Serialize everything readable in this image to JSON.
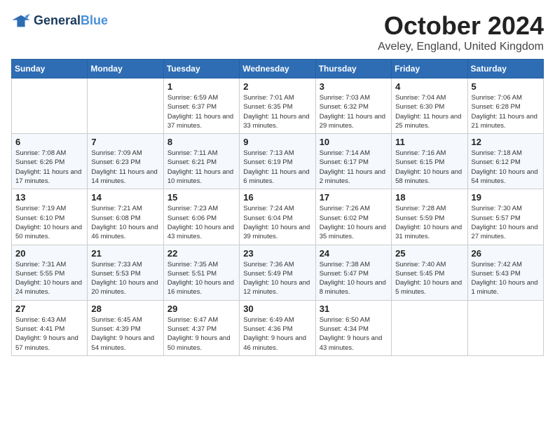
{
  "logo": {
    "line1": "General",
    "line2": "Blue"
  },
  "title": "October 2024",
  "location": "Aveley, England, United Kingdom",
  "days_of_week": [
    "Sunday",
    "Monday",
    "Tuesday",
    "Wednesday",
    "Thursday",
    "Friday",
    "Saturday"
  ],
  "weeks": [
    [
      {
        "day": "",
        "info": ""
      },
      {
        "day": "",
        "info": ""
      },
      {
        "day": "1",
        "info": "Sunrise: 6:59 AM\nSunset: 6:37 PM\nDaylight: 11 hours and 37 minutes."
      },
      {
        "day": "2",
        "info": "Sunrise: 7:01 AM\nSunset: 6:35 PM\nDaylight: 11 hours and 33 minutes."
      },
      {
        "day": "3",
        "info": "Sunrise: 7:03 AM\nSunset: 6:32 PM\nDaylight: 11 hours and 29 minutes."
      },
      {
        "day": "4",
        "info": "Sunrise: 7:04 AM\nSunset: 6:30 PM\nDaylight: 11 hours and 25 minutes."
      },
      {
        "day": "5",
        "info": "Sunrise: 7:06 AM\nSunset: 6:28 PM\nDaylight: 11 hours and 21 minutes."
      }
    ],
    [
      {
        "day": "6",
        "info": "Sunrise: 7:08 AM\nSunset: 6:26 PM\nDaylight: 11 hours and 17 minutes."
      },
      {
        "day": "7",
        "info": "Sunrise: 7:09 AM\nSunset: 6:23 PM\nDaylight: 11 hours and 14 minutes."
      },
      {
        "day": "8",
        "info": "Sunrise: 7:11 AM\nSunset: 6:21 PM\nDaylight: 11 hours and 10 minutes."
      },
      {
        "day": "9",
        "info": "Sunrise: 7:13 AM\nSunset: 6:19 PM\nDaylight: 11 hours and 6 minutes."
      },
      {
        "day": "10",
        "info": "Sunrise: 7:14 AM\nSunset: 6:17 PM\nDaylight: 11 hours and 2 minutes."
      },
      {
        "day": "11",
        "info": "Sunrise: 7:16 AM\nSunset: 6:15 PM\nDaylight: 10 hours and 58 minutes."
      },
      {
        "day": "12",
        "info": "Sunrise: 7:18 AM\nSunset: 6:12 PM\nDaylight: 10 hours and 54 minutes."
      }
    ],
    [
      {
        "day": "13",
        "info": "Sunrise: 7:19 AM\nSunset: 6:10 PM\nDaylight: 10 hours and 50 minutes."
      },
      {
        "day": "14",
        "info": "Sunrise: 7:21 AM\nSunset: 6:08 PM\nDaylight: 10 hours and 46 minutes."
      },
      {
        "day": "15",
        "info": "Sunrise: 7:23 AM\nSunset: 6:06 PM\nDaylight: 10 hours and 43 minutes."
      },
      {
        "day": "16",
        "info": "Sunrise: 7:24 AM\nSunset: 6:04 PM\nDaylight: 10 hours and 39 minutes."
      },
      {
        "day": "17",
        "info": "Sunrise: 7:26 AM\nSunset: 6:02 PM\nDaylight: 10 hours and 35 minutes."
      },
      {
        "day": "18",
        "info": "Sunrise: 7:28 AM\nSunset: 5:59 PM\nDaylight: 10 hours and 31 minutes."
      },
      {
        "day": "19",
        "info": "Sunrise: 7:30 AM\nSunset: 5:57 PM\nDaylight: 10 hours and 27 minutes."
      }
    ],
    [
      {
        "day": "20",
        "info": "Sunrise: 7:31 AM\nSunset: 5:55 PM\nDaylight: 10 hours and 24 minutes."
      },
      {
        "day": "21",
        "info": "Sunrise: 7:33 AM\nSunset: 5:53 PM\nDaylight: 10 hours and 20 minutes."
      },
      {
        "day": "22",
        "info": "Sunrise: 7:35 AM\nSunset: 5:51 PM\nDaylight: 10 hours and 16 minutes."
      },
      {
        "day": "23",
        "info": "Sunrise: 7:36 AM\nSunset: 5:49 PM\nDaylight: 10 hours and 12 minutes."
      },
      {
        "day": "24",
        "info": "Sunrise: 7:38 AM\nSunset: 5:47 PM\nDaylight: 10 hours and 8 minutes."
      },
      {
        "day": "25",
        "info": "Sunrise: 7:40 AM\nSunset: 5:45 PM\nDaylight: 10 hours and 5 minutes."
      },
      {
        "day": "26",
        "info": "Sunrise: 7:42 AM\nSunset: 5:43 PM\nDaylight: 10 hours and 1 minute."
      }
    ],
    [
      {
        "day": "27",
        "info": "Sunrise: 6:43 AM\nSunset: 4:41 PM\nDaylight: 9 hours and 57 minutes."
      },
      {
        "day": "28",
        "info": "Sunrise: 6:45 AM\nSunset: 4:39 PM\nDaylight: 9 hours and 54 minutes."
      },
      {
        "day": "29",
        "info": "Sunrise: 6:47 AM\nSunset: 4:37 PM\nDaylight: 9 hours and 50 minutes."
      },
      {
        "day": "30",
        "info": "Sunrise: 6:49 AM\nSunset: 4:36 PM\nDaylight: 9 hours and 46 minutes."
      },
      {
        "day": "31",
        "info": "Sunrise: 6:50 AM\nSunset: 4:34 PM\nDaylight: 9 hours and 43 minutes."
      },
      {
        "day": "",
        "info": ""
      },
      {
        "day": "",
        "info": ""
      }
    ]
  ]
}
